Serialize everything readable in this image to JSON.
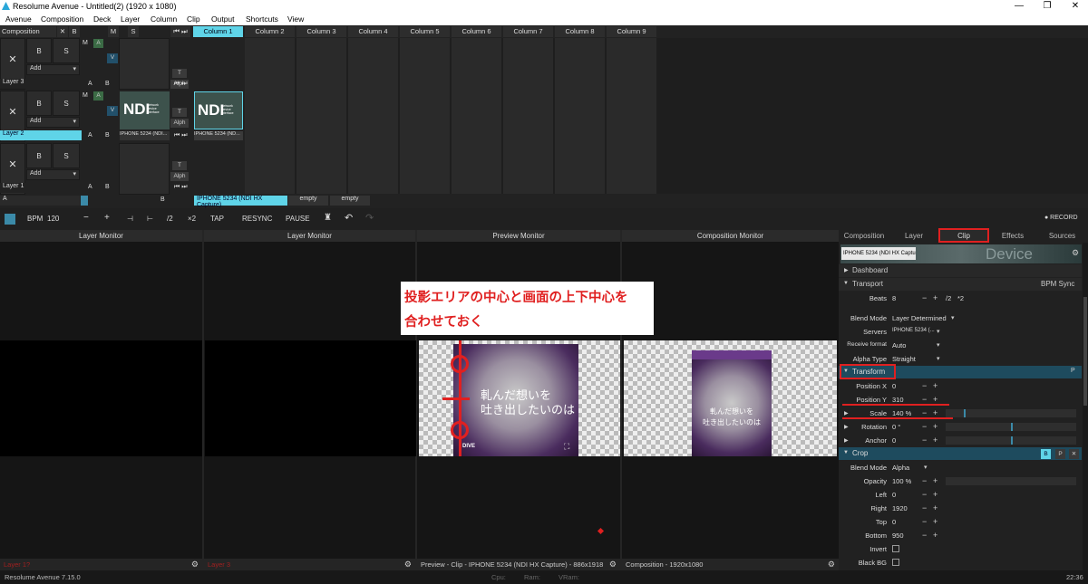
{
  "window": {
    "title": "Resolume Avenue - Untitled(2) (1920 x 1080)",
    "minimize": "—",
    "maximize": "❐",
    "close": "✕"
  },
  "menu": [
    "Avenue",
    "Composition",
    "Deck",
    "Layer",
    "Column",
    "Clip",
    "Output",
    "Shortcuts",
    "View"
  ],
  "composition": {
    "label": "Composition",
    "x": "✕",
    "b": "B",
    "m": "M",
    "s": "S"
  },
  "columns": [
    "Column 1",
    "Column 2",
    "Column 3",
    "Column 4",
    "Column 5",
    "Column 6",
    "Column 7",
    "Column 8",
    "Column 9"
  ],
  "layers": [
    {
      "name": "Layer 3",
      "selected": false,
      "clip": ""
    },
    {
      "name": "Layer 2",
      "selected": true,
      "clip": "IPHONE 5234 (NDI...",
      "thumb_clip": "IPHONE 5234 (ND..."
    },
    {
      "name": "Layer 1",
      "selected": false,
      "clip": ""
    }
  ],
  "layer_controls": {
    "x": "✕",
    "b": "B",
    "s": "S",
    "add": "Add",
    "m": "M",
    "a": "A",
    "v": "V",
    "t": "T",
    "alph": "Alph",
    "ab_a": "A",
    "ab_b": "B",
    "nav": "⏮ ⏭"
  },
  "ndi_logo": {
    "big": "NDI",
    "small": "Network Device Interface"
  },
  "deck": {
    "a": "A",
    "b": "B",
    "selected_clip": "IPHONE 5234 (NDI HX Capture)",
    "empty1": "empty",
    "empty2": "empty"
  },
  "toolbar": {
    "bpm_label": "BPM",
    "bpm_value": "120",
    "minus": "−",
    "plus": "+",
    "half": "/2",
    "double": "×2",
    "tap": "TAP",
    "resync": "RESYNC",
    "pause": "PAUSE",
    "record": "● RECORD"
  },
  "monitors": [
    {
      "title": "Layer Monitor",
      "footer": "Layer 1?"
    },
    {
      "title": "Layer Monitor",
      "footer": "Layer 3"
    },
    {
      "title": "Preview Monitor",
      "footer": "Preview - Clip - IPHONE 5234 (NDI HX Capture) - 886x1918"
    },
    {
      "title": "Composition Monitor",
      "footer": "Composition - 1920x1080"
    }
  ],
  "annotation": {
    "line1": "投影エリアの中心と画面の上下中心を",
    "line2": "合わせておく"
  },
  "preview_lyrics": {
    "line1": "軋んだ想いを",
    "line2": "吐き出したいのは",
    "badge": "DIVE"
  },
  "comp_lyrics": {
    "line1": "軋んだ想いを",
    "line2": "吐き出したいのは"
  },
  "panel": {
    "tabs": [
      "Composition",
      "Layer",
      "Clip",
      "Effects",
      "Sources"
    ],
    "clip_name": "IPHONE 5234 (NDI HX Captu...",
    "thumb_text": "Device",
    "dashboard": "Dashboard",
    "transport": "Transport",
    "transport_mode": "BPM Sync",
    "beats_label": "Beats",
    "beats_value": "8",
    "half": "/2",
    "double": "*2",
    "blend_label": "Blend Mode",
    "blend_value": "Layer Determined",
    "servers_label": "Servers",
    "servers_value": "IPHONE 5234 (...",
    "recv_label": "Receive format",
    "recv_value": "Auto",
    "alpha_label": "Alpha Type",
    "alpha_value": "Straight",
    "transform": "Transform",
    "posx_label": "Position X",
    "posx_value": "0",
    "posy_label": "Position Y",
    "posy_value": "310",
    "scale_label": "Scale",
    "scale_value": "140 %",
    "rot_label": "Rotation",
    "rot_value": "0 °",
    "anchor_label": "Anchor",
    "anchor_value": "0",
    "crop": "Crop",
    "crop_blend_label": "Blend Mode",
    "crop_blend_value": "Alpha",
    "opacity_label": "Opacity",
    "opacity_value": "100 %",
    "left_label": "Left",
    "left_value": "0",
    "right_label": "Right",
    "right_value": "1920",
    "top_label": "Top",
    "top_value": "0",
    "bottom_label": "Bottom",
    "bottom_value": "950",
    "invert_label": "Invert",
    "blackbg_label": "Black BG"
  },
  "status": {
    "version": "Resolume Avenue 7.15.0",
    "cpu": "Cpu:",
    "ram": "Ram:",
    "vram": "VRam:",
    "time": "22:36"
  }
}
